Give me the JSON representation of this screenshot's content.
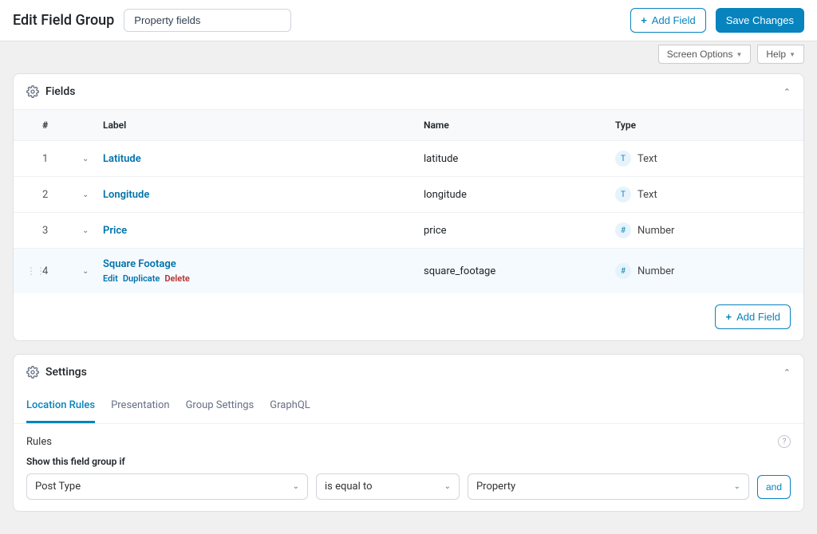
{
  "header": {
    "title": "Edit Field Group",
    "group_name": "Property fields",
    "add_field_label": "Add Field",
    "save_label": "Save Changes"
  },
  "screen_row": {
    "screen_options": "Screen Options",
    "help": "Help"
  },
  "fields_panel": {
    "title": "Fields",
    "cols": {
      "order": "#",
      "label": "Label",
      "name": "Name",
      "type": "Type"
    },
    "rows": [
      {
        "order": "1",
        "label": "Latitude",
        "name": "latitude",
        "type": "Text",
        "type_badge": "T",
        "hovered": false
      },
      {
        "order": "2",
        "label": "Longitude",
        "name": "longitude",
        "type": "Text",
        "type_badge": "T",
        "hovered": false
      },
      {
        "order": "3",
        "label": "Price",
        "name": "price",
        "type": "Number",
        "type_badge": "#",
        "hovered": false
      },
      {
        "order": "4",
        "label": "Square Footage",
        "name": "square_footage",
        "type": "Number",
        "type_badge": "#",
        "hovered": true
      }
    ],
    "row_actions": {
      "edit": "Edit",
      "duplicate": "Duplicate",
      "delete": "Delete"
    },
    "footer_add": "Add Field"
  },
  "settings_panel": {
    "title": "Settings",
    "tabs": [
      "Location Rules",
      "Presentation",
      "Group Settings",
      "GraphQL"
    ],
    "active_tab": 0,
    "rules_heading": "Rules",
    "show_if_label": "Show this field group if",
    "rule": {
      "param": "Post Type",
      "operator": "is equal to",
      "value": "Property"
    },
    "and_label": "and"
  }
}
